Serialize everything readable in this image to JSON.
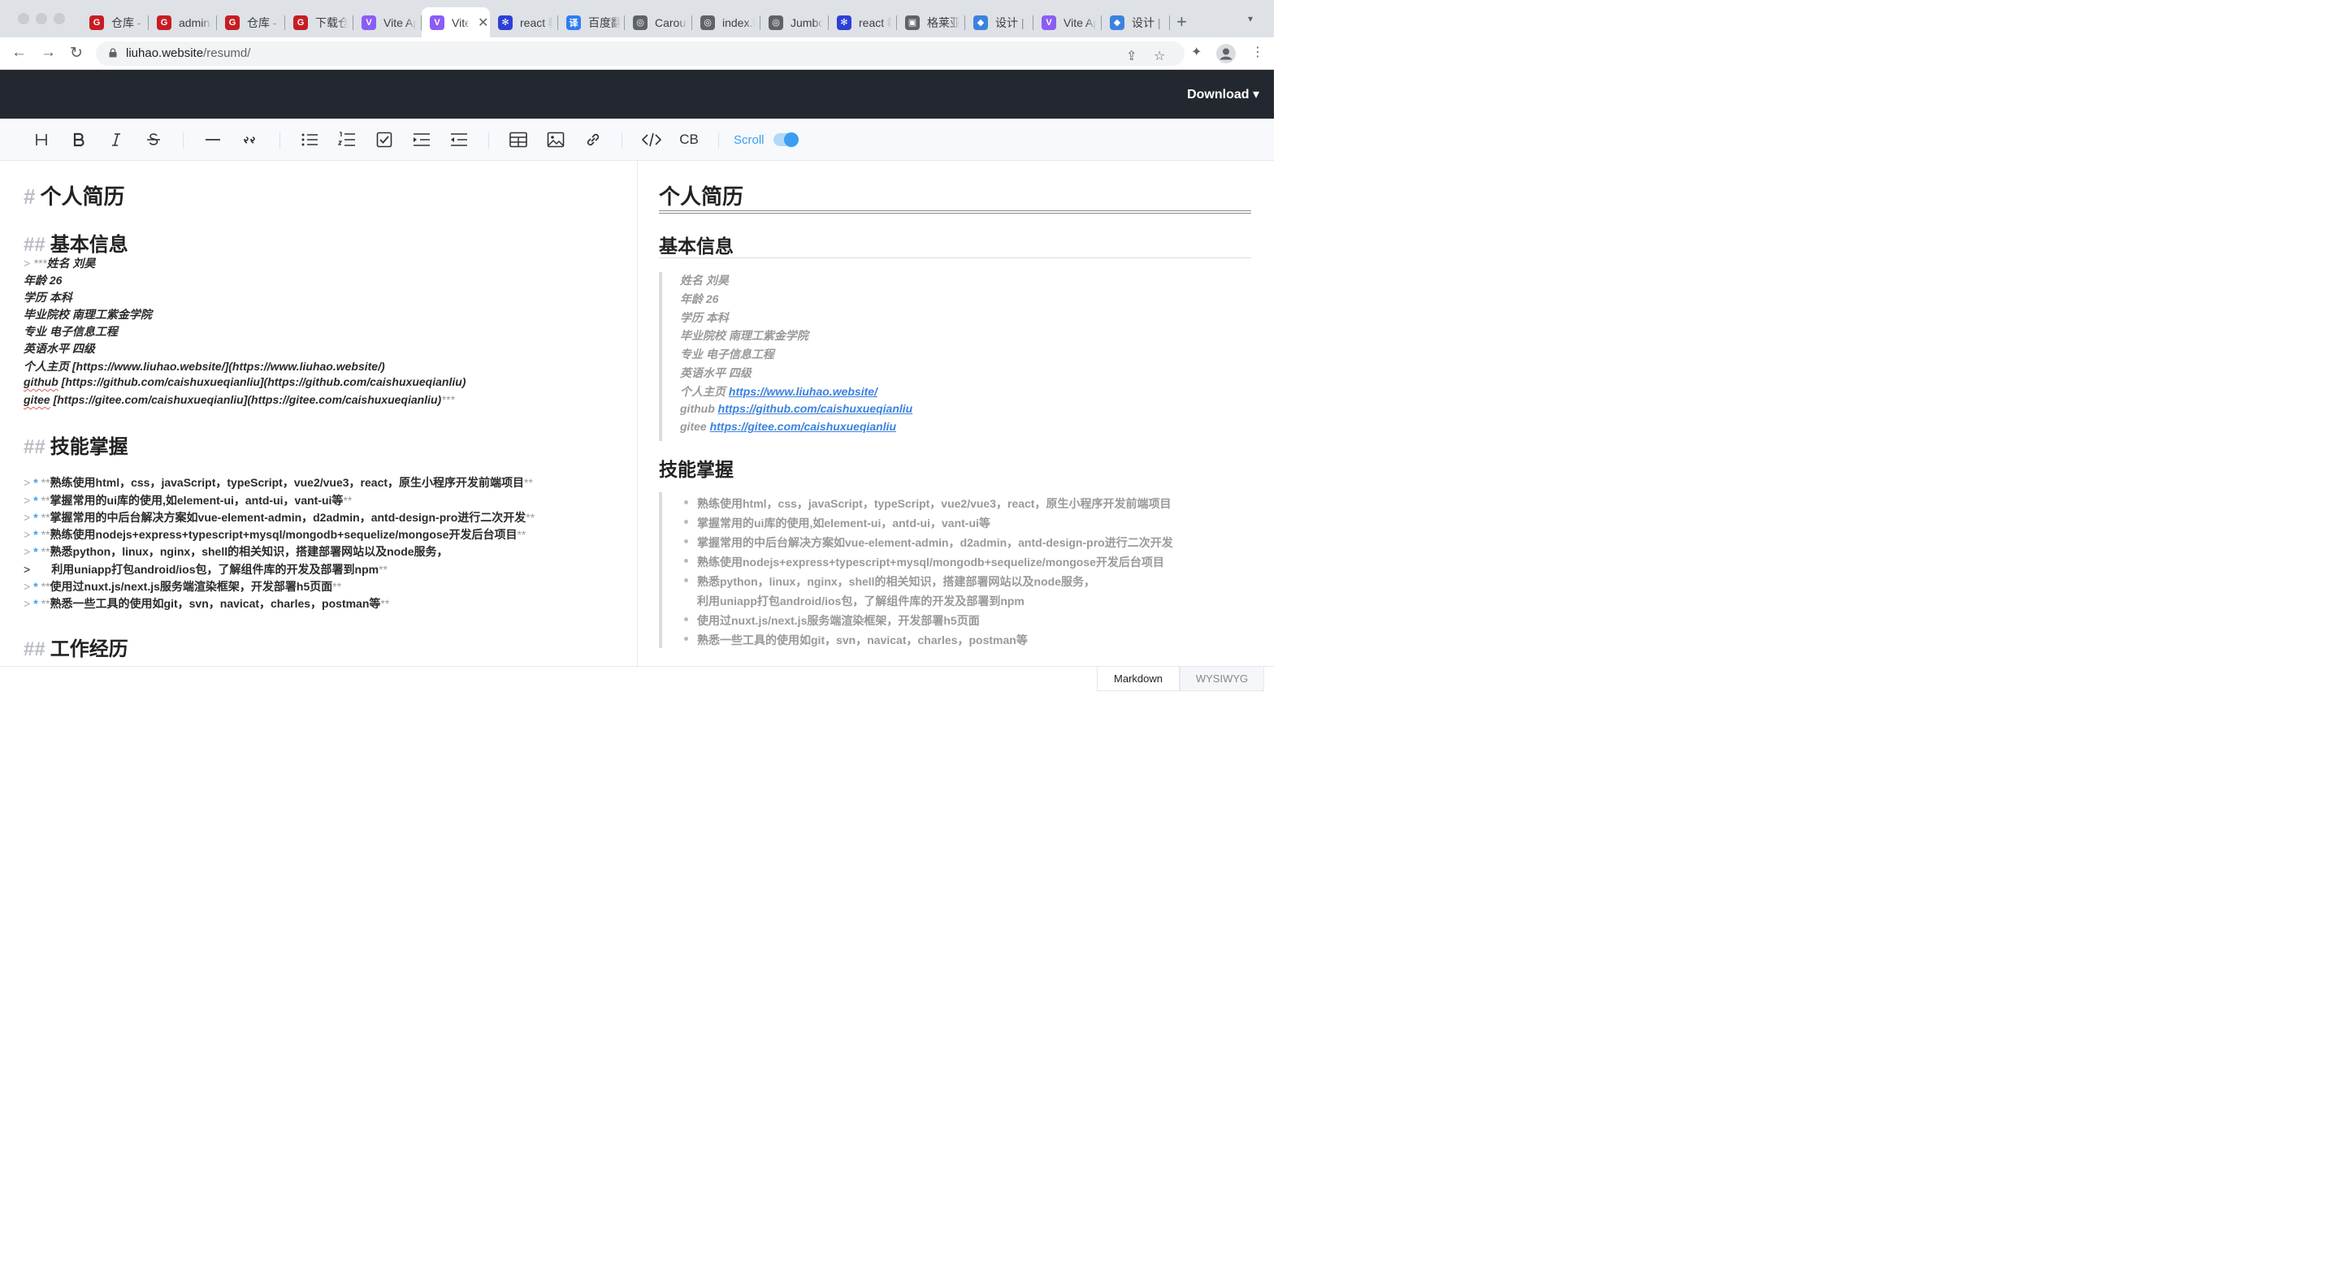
{
  "browser": {
    "tabs": [
      {
        "title": "仓库 - 码云 Gitee",
        "icon": "gitee-icon",
        "color": "#c71d23",
        "glyph": "G"
      },
      {
        "title": "admin/vite",
        "icon": "gitee-icon",
        "color": "#c71d23",
        "glyph": "G"
      },
      {
        "title": "仓库 - 码云",
        "icon": "gitee-icon",
        "color": "#c71d23",
        "glyph": "G"
      },
      {
        "title": "下载仓库",
        "icon": "gitee-icon",
        "color": "#c71d23",
        "glyph": "G"
      },
      {
        "title": "Vite App",
        "icon": "vite-icon",
        "color": "#8b5cf6",
        "glyph": "V"
      },
      {
        "title": "Vite App",
        "icon": "vite-icon",
        "color": "#8b5cf6",
        "glyph": "V",
        "active": true
      },
      {
        "title": "react 教程",
        "icon": "baidu-icon",
        "color": "#2e3fd6",
        "glyph": "✻"
      },
      {
        "title": "百度翻译",
        "icon": "translate-icon",
        "color": "#2e7cf6",
        "glyph": "译"
      },
      {
        "title": "Carousel",
        "icon": "globe-icon",
        "color": "#5f6368",
        "glyph": "◎"
      },
      {
        "title": "index.html",
        "icon": "globe-icon",
        "color": "#5f6368",
        "glyph": "◎"
      },
      {
        "title": "Jumbotron",
        "icon": "globe-icon",
        "color": "#5f6368",
        "glyph": "◎"
      },
      {
        "title": "react 教程",
        "icon": "baidu-icon",
        "color": "#2e3fd6",
        "glyph": "✻"
      },
      {
        "title": "格莱亚",
        "icon": "image-icon",
        "color": "#5f6368",
        "glyph": "▣"
      },
      {
        "title": "设计 | 即时设计",
        "icon": "design-icon",
        "color": "#3b82e0",
        "glyph": "◆"
      },
      {
        "title": "Vite App",
        "icon": "vite-icon",
        "color": "#8b5cf6",
        "glyph": "V"
      },
      {
        "title": "设计 | 即时设计",
        "icon": "design-icon",
        "color": "#3b82e0",
        "glyph": "◆"
      }
    ],
    "url_host": "liuhao.website",
    "url_path": "/resumd/"
  },
  "app": {
    "download_label": "Download ▾",
    "scroll_label": "Scroll",
    "mode_markdown": "Markdown",
    "mode_wysiwyg": "WYSIWYG"
  },
  "editor": {
    "h1": "个人简历",
    "h2_basic": "基本信息",
    "basic_lines": [
      "姓名 刘昊",
      "年龄 26",
      "学历 本科",
      "毕业院校 南理工紫金学院",
      "专业 电子信息工程",
      "英语水平 四级",
      "个人主页 [https://www.liuhao.website/](https://www.liuhao.website/)",
      "github [https://github.com/caishuxueqianliu](https://github.com/caishuxueqianliu)",
      "gitee [https://gitee.com/caishuxueqianliu](https://gitee.com/caishuxueqianliu)"
    ],
    "h2_skills": "技能掌握",
    "skill_items": [
      "熟练使用html，css，javaScript，typeScript，vue2/vue3，react，原生小程序开发前端项目",
      "掌握常用的ui库的使用,如element-ui，antd-ui，vant-ui等",
      "掌握常用的中后台解决方案如vue-element-admin，d2admin，antd-design-pro进行二次开发",
      "熟练使用nodejs+express+typescript+mysql/mongodb+sequelize/mongose开发后台项目",
      "熟悉python，linux，nginx，shell的相关知识，搭建部署网站以及node服务，",
      "利用uniapp打包android/ios包，了解组件库的开发及部署到npm",
      "使用过nuxt.js/next.js服务端渲染框架，开发部署h5页面",
      "熟悉一些工具的使用如git，svn，navicat，charles，postman等"
    ],
    "h2_work": "工作经历"
  },
  "preview": {
    "h1": "个人简历",
    "h2_basic": "基本信息",
    "basic_lines": [
      {
        "text": "姓名 刘昊"
      },
      {
        "text": "年龄 26"
      },
      {
        "text": "学历 本科"
      },
      {
        "text": "毕业院校 南理工紫金学院"
      },
      {
        "text": "专业 电子信息工程"
      },
      {
        "text": "英语水平 四级"
      },
      {
        "text": "个人主页 ",
        "link": "https://www.liuhao.website/"
      },
      {
        "text": "github ",
        "link": "https://github.com/caishuxueqianliu"
      },
      {
        "text": "gitee ",
        "link": "https://gitee.com/caishuxueqianliu"
      }
    ],
    "h2_skills": "技能掌握",
    "skill_items": [
      "熟练使用html，css，javaScript，typeScript，vue2/vue3，react，原生小程序开发前端项目",
      "掌握常用的ui库的使用,如element-ui，antd-ui，vant-ui等",
      "掌握常用的中后台解决方案如vue-element-admin，d2admin，antd-design-pro进行二次开发",
      "熟练使用nodejs+express+typescript+mysql/mongodb+sequelize/mongose开发后台项目",
      "熟悉python，linux，nginx，shell的相关知识，搭建部署网站以及node服务，",
      "利用uniapp打包android/ios包，了解组件库的开发及部署到npm",
      "使用过nuxt.js/next.js服务端渲染框架，开发部署h5页面",
      "熟悉一些工具的使用如git，svn，navicat，charles，postman等"
    ]
  },
  "colors": {
    "accent": "#3b9ef0",
    "header_bg": "#23272f",
    "link": "#3b82e0"
  }
}
